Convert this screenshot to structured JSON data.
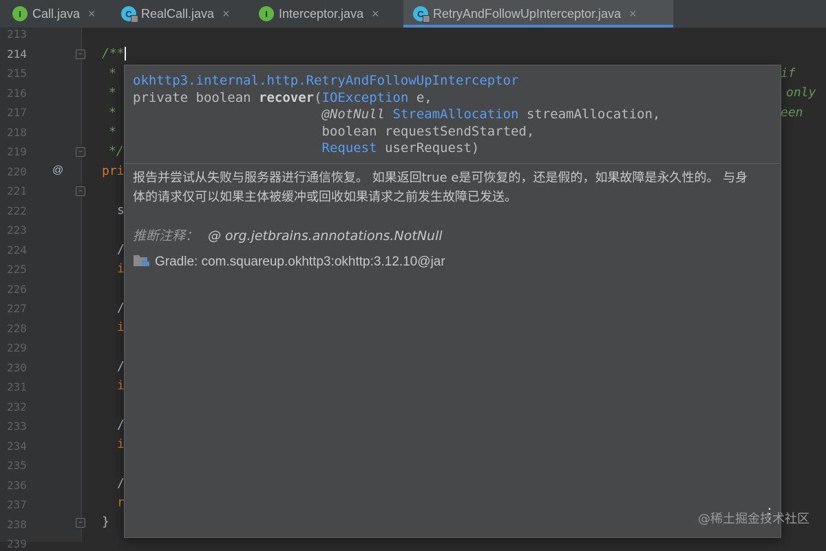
{
  "tabs": [
    {
      "label": "Call.java",
      "icon": "interface-icon",
      "icon_letter": "I",
      "active": false
    },
    {
      "label": "RealCall.java",
      "icon": "class-icon",
      "icon_letter": "C",
      "active": false
    },
    {
      "label": "Interceptor.java",
      "icon": "interface-icon",
      "icon_letter": "I",
      "active": false
    },
    {
      "label": "RetryAndFollowUpInterceptor.java",
      "icon": "class-icon",
      "icon_letter": "C",
      "active": true
    }
  ],
  "close_glyph": "×",
  "editor": {
    "line_numbers": [
      "213",
      "214",
      "215",
      "216",
      "217",
      "218",
      "219",
      "220",
      "221",
      "222",
      "223",
      "224",
      "225",
      "226",
      "227",
      "228",
      "229",
      "230",
      "231",
      "232",
      "233",
      "234",
      "235",
      "236",
      "237",
      "238",
      "239"
    ],
    "current_line": "214",
    "override_marker": "@",
    "code": {
      "doc_open": "/**",
      "doc_star": "*",
      "doc_close": "*/",
      "line220": "pri",
      "line222": "s",
      "comment_slash": "/",
      "if_prefix": "i",
      "return_prefix": "r",
      "close_brace": "}",
      "right_if": "if",
      "right_only": "only",
      "right_een": "een"
    }
  },
  "popup": {
    "signature": {
      "qualified_class": "okhttp3.internal.http.RetryAndFollowUpInterceptor",
      "modifiers": "private boolean ",
      "method": "recover",
      "open_paren": "(",
      "p1_type": "IOException",
      "p1_name": " e,",
      "p2_anno": "@NotNull",
      "p2_type": "StreamAllocation",
      "p2_name": " streamAllocation,",
      "p3": "boolean requestSendStarted,",
      "p4_type": "Request",
      "p4_name": " userRequest)"
    },
    "description": "报告并尝试从失败与服务器进行通信恢复。 如果返回true e是可恢复的，还是假的，如果故障是永久性的。 与身体的请求仅可以如果主体被缓冲或回收如果请求之前发生故障已发送。",
    "inferred_label": "推断注释：",
    "inferred_value": "@ org.jetbrains.annotations.NotNull",
    "gradle_text": "Gradle: com.squareup.okhttp3:okhttp:3.12.10@jar",
    "more_glyph": "⋮"
  },
  "watermark": "@稀土掘金技术社区",
  "colors": {
    "editor_bg": "#2b2b2b",
    "popup_bg": "#46484a",
    "link": "#589df6",
    "doc_comment": "#629755",
    "keyword": "#cc7832",
    "tab_underline": "#4a88c7"
  }
}
